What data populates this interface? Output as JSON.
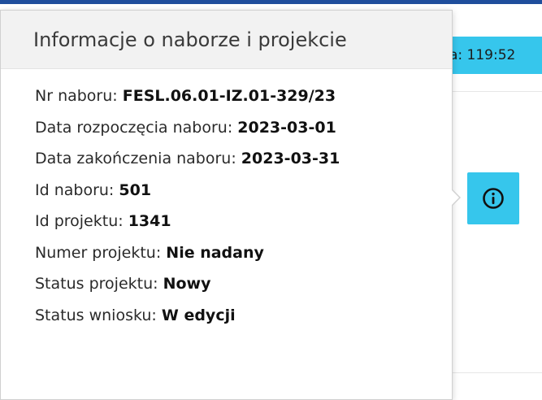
{
  "session": {
    "timer_text": "a: 119:52"
  },
  "popover": {
    "title": "Informacje o naborze i projekcie",
    "rows": [
      {
        "label": "Nr naboru: ",
        "value": "FESL.06.01-IZ.01-329/23"
      },
      {
        "label": "Data rozpoczęcia naboru: ",
        "value": "2023-03-01"
      },
      {
        "label": "Data zakończenia naboru: ",
        "value": "2023-03-31"
      },
      {
        "label": "Id naboru: ",
        "value": "501"
      },
      {
        "label": "Id projektu: ",
        "value": "1341"
      },
      {
        "label": "Numer projektu: ",
        "value": "Nie nadany"
      },
      {
        "label": "Status projektu: ",
        "value": "Nowy"
      },
      {
        "label": "Status wniosku: ",
        "value": "W edycji"
      }
    ]
  },
  "info_button": {
    "icon": "info-circle-icon"
  },
  "colors": {
    "top_bar": "#1f4e9c",
    "accent": "#36c6ec"
  }
}
